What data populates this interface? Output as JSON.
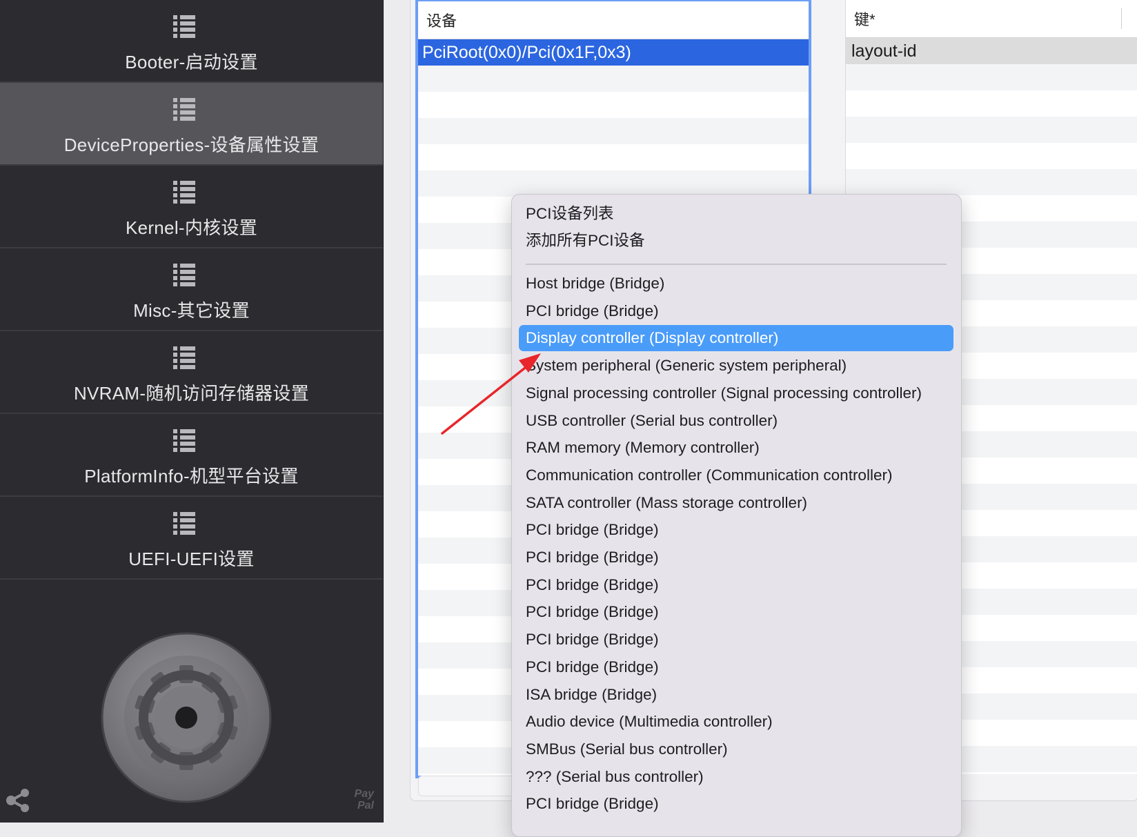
{
  "sidebar": {
    "items": [
      {
        "label": "Booter-启动设置",
        "active": false
      },
      {
        "label": "DeviceProperties-设备属性设置",
        "active": true
      },
      {
        "label": "Kernel-内核设置",
        "active": false
      },
      {
        "label": "Misc-其它设置",
        "active": false
      },
      {
        "label": "NVRAM-随机访问存储器设置",
        "active": false
      },
      {
        "label": "PlatformInfo-机型平台设置",
        "active": false
      },
      {
        "label": "UEFI-UEFI设置",
        "active": false
      }
    ],
    "paypal": "Pay Pal",
    "icons": [
      "list-icon",
      "gear-logo",
      "share-icon"
    ]
  },
  "devices_table": {
    "header": "设备",
    "rows": [
      "PciRoot(0x0)/Pci(0x1F,0x3)"
    ]
  },
  "keys_table": {
    "header": "键*",
    "rows": [
      "layout-id"
    ]
  },
  "menu": {
    "top_items": [
      "PCI设备列表",
      "添加所有PCI设备"
    ],
    "items": [
      "Host bridge (Bridge)",
      "PCI bridge (Bridge)",
      "Display controller (Display controller)",
      "System peripheral (Generic system peripheral)",
      "Signal processing controller (Signal processing controller)",
      "USB controller (Serial bus controller)",
      "RAM memory (Memory controller)",
      "Communication controller (Communication controller)",
      "SATA controller (Mass storage controller)",
      "PCI bridge (Bridge)",
      "PCI bridge (Bridge)",
      "PCI bridge (Bridge)",
      "PCI bridge (Bridge)",
      "PCI bridge (Bridge)",
      "PCI bridge (Bridge)",
      "ISA bridge (Bridge)",
      "Audio device (Multimedia controller)",
      "SMBus (Serial bus controller)",
      "??? (Serial bus controller)",
      "PCI bridge (Bridge)"
    ],
    "highlighted_index": 2
  },
  "colors": {
    "sidebar_bg": "#2c2b2f",
    "sidebar_active": "#56555a",
    "selection_blue": "#2b66e0",
    "menu_highlight": "#4a9cf9",
    "annotation_arrow": "#e8262b"
  }
}
